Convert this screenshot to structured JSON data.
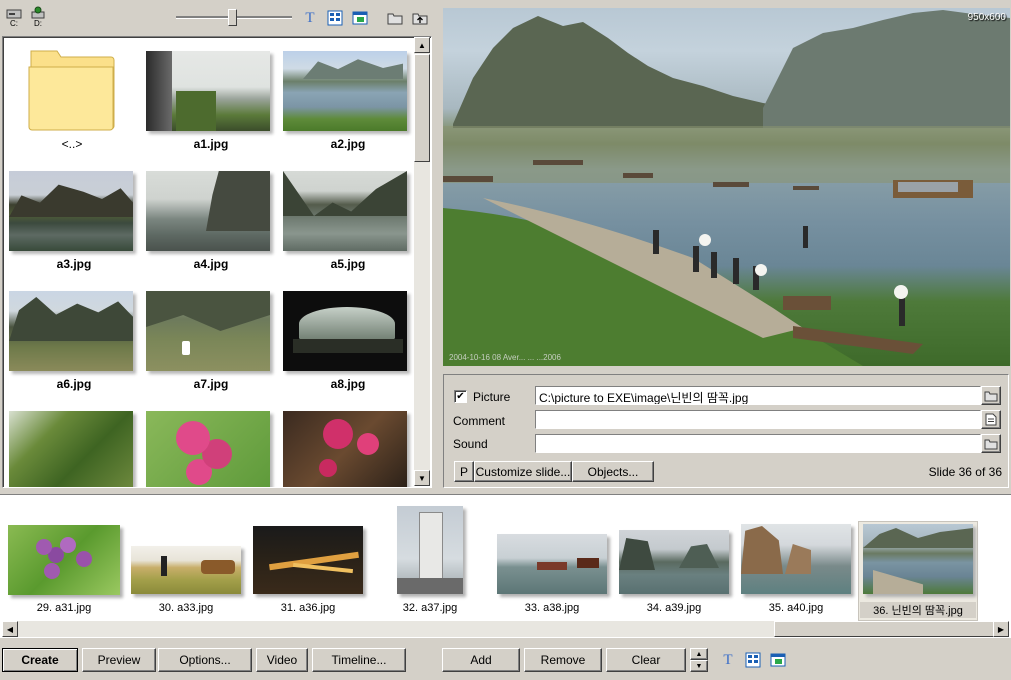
{
  "toolbar": {
    "drive_c": "C:",
    "drive_d": "D:"
  },
  "browser": {
    "items": [
      {
        "label": "<..>"
      },
      {
        "label": "a1.jpg"
      },
      {
        "label": "a2.jpg"
      },
      {
        "label": "a3.jpg"
      },
      {
        "label": "a4.jpg"
      },
      {
        "label": "a5.jpg"
      },
      {
        "label": "a6.jpg"
      },
      {
        "label": "a7.jpg"
      },
      {
        "label": "a8.jpg"
      }
    ]
  },
  "preview": {
    "size_label": "950x600",
    "timestamp": "2004-10-16 08 Aver... ... ...2006"
  },
  "properties": {
    "picture_label": "Picture",
    "picture_checked": true,
    "picture_value": "C:\\picture to EXE\\image\\닌빈의 땀꼭.jpg",
    "comment_label": "Comment",
    "comment_value": "",
    "sound_label": "Sound",
    "sound_value": "",
    "p_button": "P",
    "customize_button": "Customize slide...",
    "objects_button": "Objects...",
    "slide_counter": "Slide 36 of 36"
  },
  "strip": {
    "items": [
      {
        "label": "29. a31.jpg"
      },
      {
        "label": "30. a33.jpg"
      },
      {
        "label": "31. a36.jpg"
      },
      {
        "label": "32. a37.jpg"
      },
      {
        "label": "33. a38.jpg"
      },
      {
        "label": "34. a39.jpg"
      },
      {
        "label": "35. a40.jpg"
      },
      {
        "label": "36. 닌빈의 땀꼭.jpg"
      }
    ]
  },
  "bottom": {
    "create": "Create",
    "preview": "Preview",
    "options": "Options...",
    "video": "Video",
    "timeline": "Timeline...",
    "add": "Add",
    "remove": "Remove",
    "clear": "Clear"
  },
  "colors": {
    "window_bg": "#d4d0c8",
    "selection_bg": "#ece9e0",
    "accent_blue": "#1a5fb4"
  }
}
